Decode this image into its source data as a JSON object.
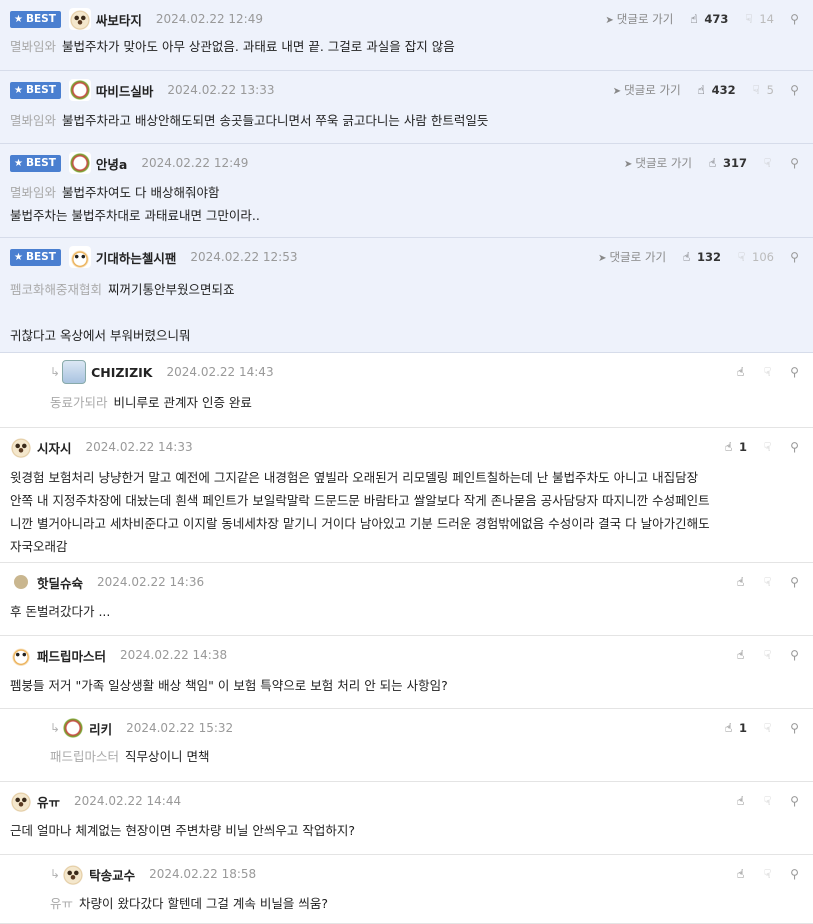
{
  "best_label": "BEST",
  "goto_label": "댓글로 가기",
  "comments": [
    {
      "best": true,
      "reply": false,
      "avatar": "dog-icon",
      "nick": "싸보타지",
      "date": "2024.02.22 12:49",
      "up": "473",
      "down": "14",
      "mention": "멸봐임와",
      "text": [
        "불법주차가 맞아도 아무 상관없음. 과태료 내면 끝. 그걸로 과실을 잡지 않음"
      ]
    },
    {
      "best": true,
      "reply": false,
      "avatar": "clown-icon",
      "nick": "따비드실바",
      "date": "2024.02.22 13:33",
      "up": "432",
      "down": "5",
      "mention": "멸봐임와",
      "text": [
        "불법주차라고 배상안해도되면 송곳들고다니면서 쭈욱 긁고다니는 사람 한트럭일듯"
      ]
    },
    {
      "best": true,
      "reply": false,
      "avatar": "clown-icon",
      "nick": "안녕a",
      "date": "2024.02.22 12:49",
      "up": "317",
      "down": "",
      "mention": "멸봐임와",
      "text": [
        "불법주차여도 다 배상해줘야함",
        "불법주차는 불법주차대로 과태료내면 그만이라.."
      ]
    },
    {
      "best": true,
      "reply": false,
      "avatar": "fox-icon",
      "nick": "기대하는첼시팬",
      "date": "2024.02.22 12:53",
      "up": "132",
      "down": "106",
      "mention": "펨코화해중재협회",
      "text": [
        "찌꺼기통안부웠으면되죠",
        "",
        "귀찮다고 옥상에서 부워버렸으니뭐"
      ]
    },
    {
      "best": false,
      "reply": true,
      "avatar": "ghost-icon",
      "nick": "CHIZIZIK",
      "date": "2024.02.22 14:43",
      "up": "",
      "down": "",
      "mention": "동료가되라",
      "text": [
        "비니루로 관계자 인증 완료"
      ]
    },
    {
      "best": false,
      "reply": false,
      "avatar": "dog-icon",
      "nick": "시자시",
      "date": "2024.02.22 14:33",
      "up": "1",
      "down": "",
      "mention": "",
      "text": [
        "윗경험 보험처리 냥냥한거 말고 예전에 그지같은 내경험은 옆빌라 오래된거 리모델링 페인트칠하는데 난 불법주차도 아니고 내집담장",
        "안쪽 내 지정주차장에 대놨는데 흰색 페인트가 보일락말락 드문드문 바람타고 쌀알보다 작게 존나묻음 공사담당자 따지니깐 수성페인트",
        "니깐 별거아니라고 세차비준다고 이지랄 동네세차장 맡기니 거이다 남아있고 기분 드러운 경험밖에없음 수성이라 결국 다 날아가긴해도",
        "자국오래감"
      ]
    },
    {
      "best": false,
      "reply": false,
      "avatar": "circle-icon",
      "nick": "핫딜슈슉",
      "date": "2024.02.22 14:36",
      "up": "",
      "down": "",
      "mention": "",
      "text": [
        "후 돈벌려갔다가 ..."
      ]
    },
    {
      "best": false,
      "reply": false,
      "avatar": "fox-icon",
      "nick": "패드립마스터",
      "date": "2024.02.22 14:38",
      "up": "",
      "down": "",
      "mention": "",
      "text": [
        "펨붕들 저거 \"가족 일상생활 배상 책임\" 이 보험 특약으로 보험 처리 안 되는 사항임?"
      ]
    },
    {
      "best": false,
      "reply": true,
      "avatar": "clown-icon",
      "nick": "리키",
      "date": "2024.02.22 15:32",
      "up": "1",
      "down": "",
      "mention": "패드립마스터",
      "text": [
        "직무상이니 면책"
      ]
    },
    {
      "best": false,
      "reply": false,
      "avatar": "dog-icon",
      "nick": "유ㅠ",
      "date": "2024.02.22 14:44",
      "up": "",
      "down": "",
      "mention": "",
      "text": [
        "근데 얼마나 체계없는 현장이면 주변차량 비닐 안씌우고 작업하지?"
      ]
    },
    {
      "best": false,
      "reply": true,
      "avatar": "dog-icon",
      "nick": "탁송교수",
      "date": "2024.02.22 18:58",
      "up": "",
      "down": "",
      "mention": "유ㅠ",
      "text": [
        "차량이 왔다갔다 할텐데 그걸 계속 비닐을 씌움?"
      ]
    }
  ]
}
